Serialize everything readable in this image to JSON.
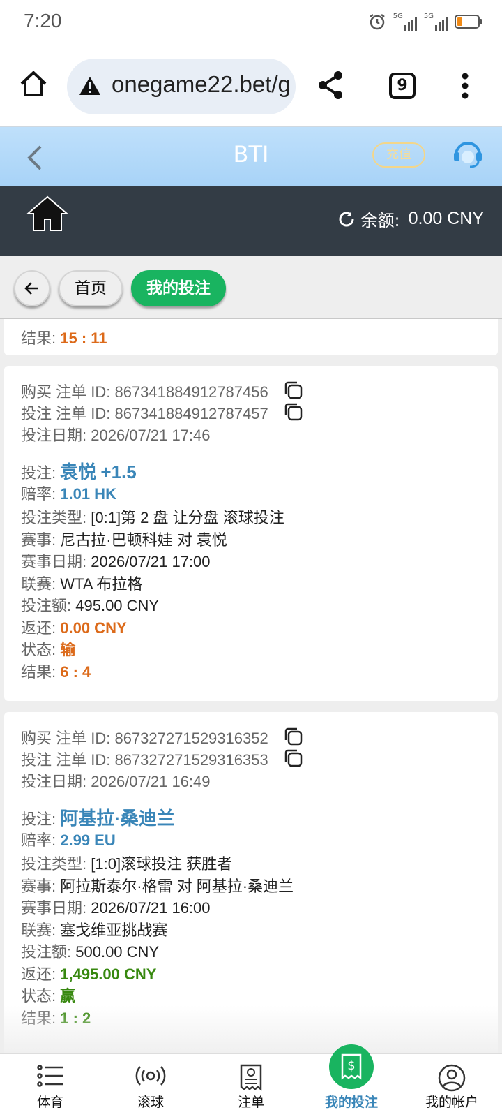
{
  "status": {
    "time": "7:20",
    "net1": "5G",
    "net2": "5G"
  },
  "browser": {
    "url": "onegame22.bet/g",
    "tab_count": "9"
  },
  "app": {
    "title": "BTI",
    "recharge_label": "充值"
  },
  "account": {
    "balance_label": "余额:",
    "balance_value": "0.00 CNY"
  },
  "nav": {
    "home_label": "首页",
    "my_bets_label": "我的投注"
  },
  "labels": {
    "result": "结果:",
    "purchase_id": "购买 注单 ID:",
    "bet_id": "投注 注单 ID:",
    "bet_date": "投注日期:",
    "bet": "投注:",
    "odds": "赔率:",
    "bet_type": "投注类型:",
    "event": "赛事:",
    "event_date": "赛事日期:",
    "league": "联赛:",
    "stake": "投注额:",
    "return": "返还:",
    "status": "状态:"
  },
  "prev_card": {
    "result": "15 : 11"
  },
  "bets": [
    {
      "purchase_id": "867341884912787456",
      "bet_id": "867341884912787457",
      "bet_date": "2026/07/21 17:46",
      "selection": "袁悦",
      "handicap": "+1.5",
      "odds": "1.01 HK",
      "bet_type": "[0:1]第 2 盘 让分盘 滚球投注",
      "event": "尼古拉·巴顿科娃 对 袁悦",
      "event_date": "2026/07/21 17:00",
      "league": "WTA 布拉格",
      "stake": "495.00 CNY",
      "return": "0.00 CNY",
      "status": "输",
      "result": "6 : 4",
      "status_color": "#dc6a1a"
    },
    {
      "purchase_id": "867327271529316352",
      "bet_id": "867327271529316353",
      "bet_date": "2026/07/21 16:49",
      "selection": "阿基拉·桑迪兰",
      "handicap": "",
      "odds": "2.99 EU",
      "bet_type": "[1:0]滚球投注 获胜者",
      "event": "阿拉斯泰尔·格雷 对 阿基拉·桑迪兰",
      "event_date": "2026/07/21 16:00",
      "league": "塞戈维亚挑战赛",
      "stake": "500.00 CNY",
      "return": "1,495.00 CNY",
      "status": "赢",
      "result": "1 : 2",
      "status_color": "#37880f"
    }
  ],
  "tabbar": {
    "sports": "体育",
    "live": "滚球",
    "slips": "注单",
    "my_bets": "我的投注",
    "account": "我的帐户"
  }
}
